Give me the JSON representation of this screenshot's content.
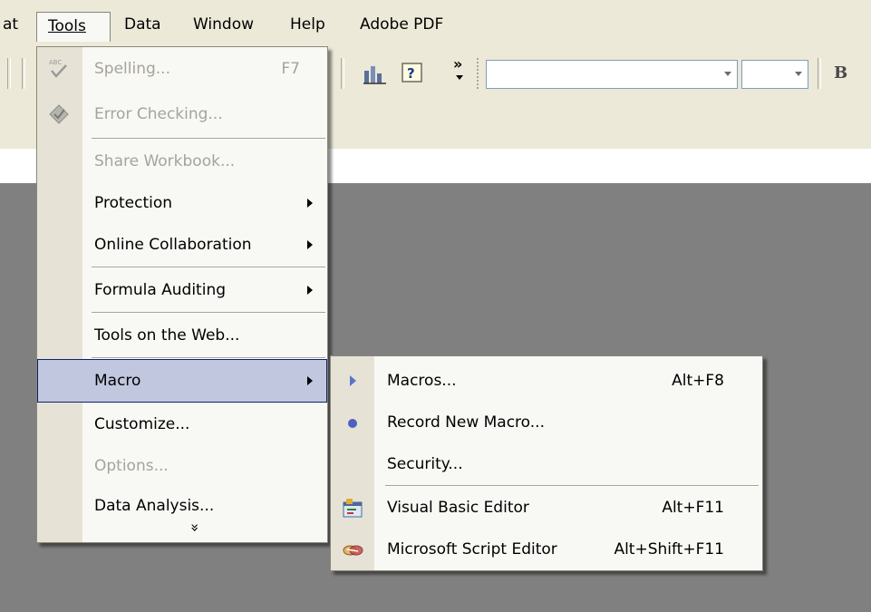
{
  "menubar": {
    "items": [
      {
        "label": "at"
      },
      {
        "label": "Tools"
      },
      {
        "label": "Data"
      },
      {
        "label": "Window"
      },
      {
        "label": "Help"
      },
      {
        "label": "Adobe PDF"
      }
    ]
  },
  "tools_menu": {
    "items": [
      {
        "label": "Spelling...",
        "shortcut": "F7",
        "disabled": true,
        "icon": "spelling-icon"
      },
      {
        "label": "Error Checking...",
        "disabled": true,
        "icon": "error-checking-icon"
      },
      {
        "label": "Share Workbook...",
        "disabled": true
      },
      {
        "label": "Protection",
        "submenu": true
      },
      {
        "label": "Online Collaboration",
        "submenu": true
      },
      {
        "label": "Formula Auditing",
        "submenu": true
      },
      {
        "label": "Tools on the Web..."
      },
      {
        "label": "Macro",
        "submenu": true,
        "highlighted": true
      },
      {
        "label": "Customize..."
      },
      {
        "label": "Options...",
        "disabled": true
      },
      {
        "label": "Data Analysis..."
      }
    ],
    "expand_glyph": "»"
  },
  "macro_submenu": {
    "items": [
      {
        "label": "Macros...",
        "shortcut": "Alt+F8",
        "icon": "play-icon"
      },
      {
        "label": "Record New Macro...",
        "icon": "record-icon"
      },
      {
        "label": "Security..."
      },
      {
        "label": "Visual Basic Editor",
        "shortcut": "Alt+F11",
        "icon": "vb-editor-icon"
      },
      {
        "label": "Microsoft Script Editor",
        "shortcut": "Alt+Shift+F11",
        "icon": "script-editor-icon"
      }
    ]
  },
  "toolbar": {
    "overflow_glyph": "»",
    "bold_label": "B"
  },
  "colors": {
    "menu_highlight": "#c1c7de",
    "highlight_border": "#0a246a",
    "chrome": "#ece9d8",
    "workspace": "#808080",
    "disabled_text": "#a6a39a"
  }
}
